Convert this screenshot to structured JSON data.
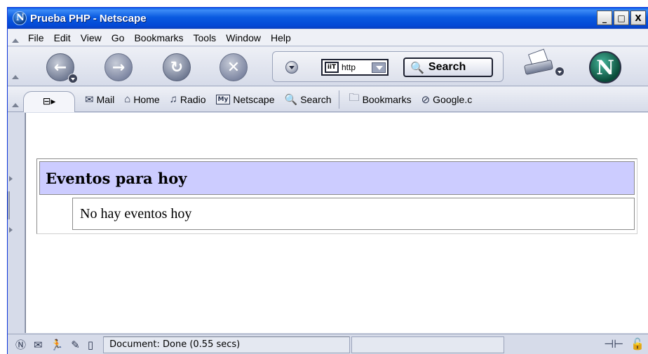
{
  "window": {
    "title": "Prueba PHP - Netscape",
    "controls": {
      "minimize": "_",
      "maximize": "□",
      "close": "X"
    }
  },
  "menu": {
    "items": [
      "File",
      "Edit",
      "View",
      "Go",
      "Bookmarks",
      "Tools",
      "Window",
      "Help"
    ]
  },
  "navbar": {
    "back_icon": "back-arrow-icon",
    "forward_icon": "forward-arrow-icon",
    "reload_icon": "reload-icon",
    "stop_icon": "stop-icon",
    "url_text": "http",
    "search_label": "Search"
  },
  "personal_toolbar": {
    "mail": "Mail",
    "home": "Home",
    "radio": "Radio",
    "my_badge": "My",
    "netscape": "Netscape",
    "search": "Search",
    "bookmarks": "Bookmarks",
    "google": "Google.c"
  },
  "page": {
    "events_header": "Eventos para hoy",
    "events_row": "No hay eventos hoy",
    "header_bg": "#ccccff"
  },
  "status": {
    "text": "Document: Done (0.55 secs)"
  }
}
